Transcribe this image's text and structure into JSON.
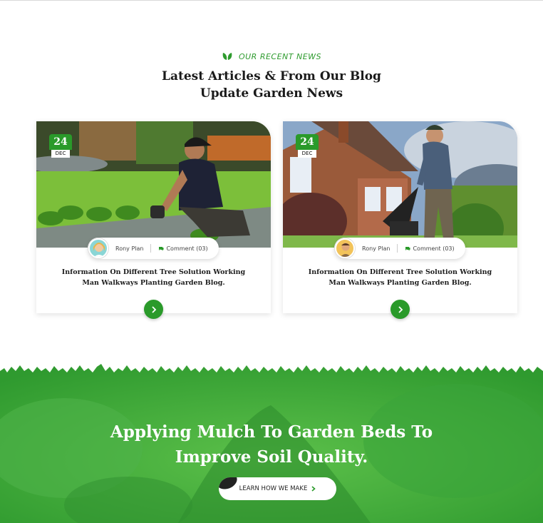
{
  "colors": {
    "accent": "#2a9a2a",
    "title": "#1a1a1a",
    "banner": "#3fae3f"
  },
  "section": {
    "eyebrow": "OUR RECENT NEWS",
    "title_line1": "Latest Articles & From Our Blog",
    "title_line2": "Update Garden News"
  },
  "posts": [
    {
      "day": "24",
      "month": "DEC",
      "author": "Rony Plan",
      "comments": "Comment (03)",
      "title": "Information On Different Tree Solution Working Man Walkways Planting Garden Blog.",
      "image": "gardener-planting-lawn"
    },
    {
      "day": "24",
      "month": "DEC",
      "author": "Rony Plan",
      "comments": "Comment (03)",
      "title": "Information On Different Tree Solution Working Man Walkways Planting Garden Blog.",
      "image": "man-mowing-lawn-by-house"
    }
  ],
  "banner": {
    "title_line1": "Applying Mulch To Garden Beds To",
    "title_line2": "Improve Soil Quality.",
    "cta_label": "LEARN HOW WE MAKE"
  },
  "icons": {
    "leaf": "leaf-icon",
    "comment": "comment-icon",
    "chevron": "chevron-right-icon"
  }
}
